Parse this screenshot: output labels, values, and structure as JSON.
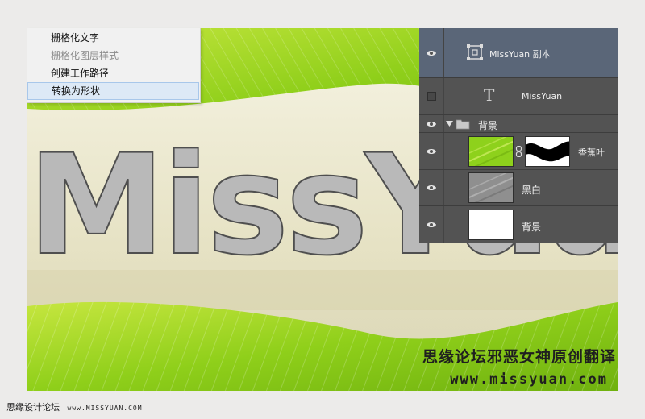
{
  "canvas": {
    "big_text": "MissYuan",
    "watermark_cn": "思缘论坛邪恶女神原创翻译",
    "watermark_url": "www.missyuan.com"
  },
  "context_menu": {
    "items": [
      {
        "label": "栅格化文字",
        "state": "normal"
      },
      {
        "label": "栅格化图层样式",
        "state": "disabled"
      },
      {
        "label": "创建工作路径",
        "state": "normal"
      },
      {
        "label": "转换为形状",
        "state": "highlighted"
      }
    ]
  },
  "layers": {
    "rows": [
      {
        "name": "MissYuan 副本",
        "kind": "smart-object",
        "visible": true,
        "selected": true
      },
      {
        "name": "MissYuan",
        "kind": "text",
        "visible": false,
        "glyph": "T"
      },
      {
        "name": "背景",
        "kind": "group",
        "visible": true
      },
      {
        "name": "香蕉叶",
        "kind": "image-with-mask",
        "visible": true
      },
      {
        "name": "黑白",
        "kind": "image",
        "visible": true
      },
      {
        "name": "背景",
        "kind": "image",
        "visible": true
      }
    ]
  },
  "footer": {
    "site_cn": "思缘设计论坛",
    "site_url": "www.MISSYUAN.COM"
  },
  "colors": {
    "panel_bg": "#535353",
    "selected_layer": "#5a6678",
    "leaf_green": "#9fd22a",
    "menu_highlight": "#dde9f6"
  }
}
